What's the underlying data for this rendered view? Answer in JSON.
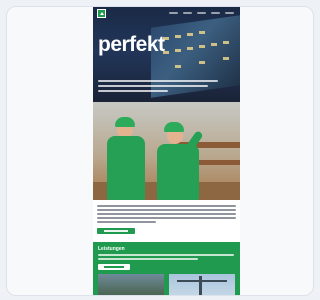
{
  "email": {
    "hero": {
      "title": "perfekt"
    },
    "section": {
      "title": "Leistungen"
    }
  },
  "colors": {
    "brand_green": "#1f9a4e",
    "hero_dark": "#1a2a46",
    "page_background": "#eef1f5"
  },
  "icons": [
    "company-logo-icon"
  ]
}
